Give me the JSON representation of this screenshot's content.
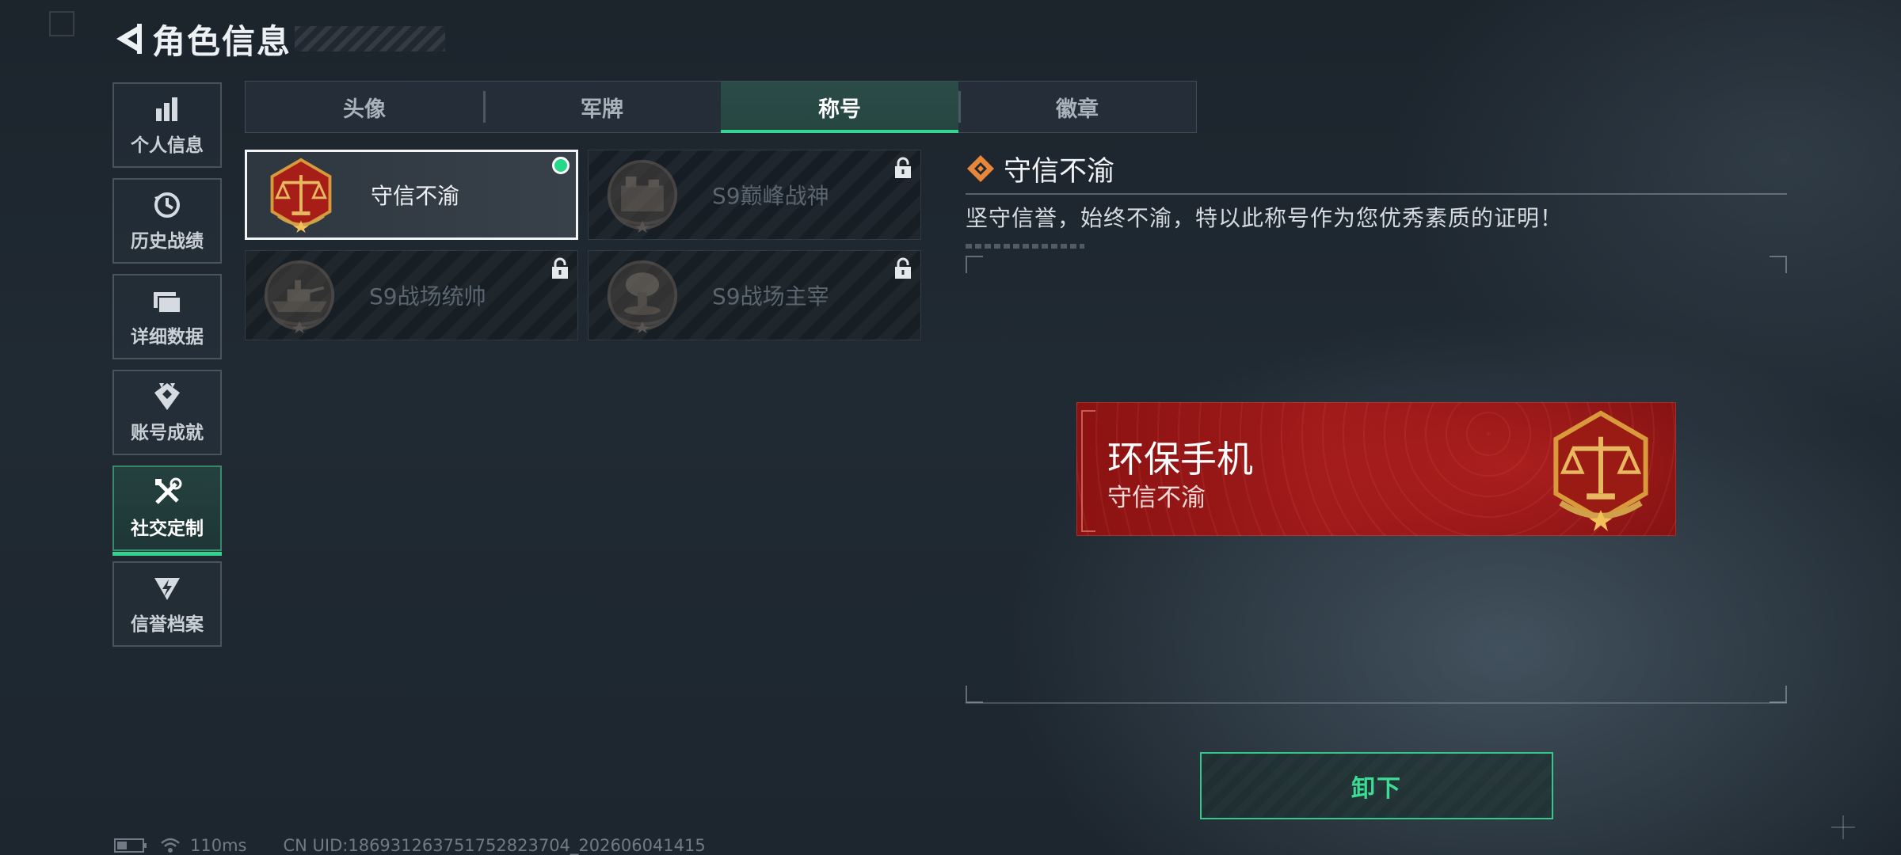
{
  "header": {
    "title": "角色信息",
    "back_icon": "chevron-left-icon"
  },
  "sidebar": {
    "items": [
      {
        "label": "个人信息",
        "icon": "bar-chart-icon",
        "active": false
      },
      {
        "label": "历史战绩",
        "icon": "history-clock-icon",
        "active": false
      },
      {
        "label": "详细数据",
        "icon": "folder-icon",
        "active": false
      },
      {
        "label": "账号成就",
        "icon": "achievement-icon",
        "active": false
      },
      {
        "label": "社交定制",
        "icon": "tools-icon",
        "active": true
      },
      {
        "label": "信誉档案",
        "icon": "emblem-icon",
        "active": false
      }
    ]
  },
  "tabs": [
    {
      "label": "头像",
      "active": false
    },
    {
      "label": "军牌",
      "active": false
    },
    {
      "label": "称号",
      "active": true
    },
    {
      "label": "徽章",
      "active": false
    }
  ],
  "titles": [
    {
      "name": "守信不渝",
      "badge": "justice-scale-badge",
      "selected": true,
      "locked": false
    },
    {
      "name": "S9巅峰战神",
      "badge": "fortress-badge",
      "selected": false,
      "locked": true
    },
    {
      "name": "S9战场统帅",
      "badge": "warship-badge",
      "selected": false,
      "locked": true
    },
    {
      "name": "S9战场主宰",
      "badge": "mushroom-cloud-badge",
      "selected": false,
      "locked": true
    }
  ],
  "detail": {
    "title": "守信不渝",
    "description": "坚守信誉，始终不渝，特以此称号作为您优秀素质的证明！"
  },
  "nameplate": {
    "player_name": "环保手机",
    "title": "守信不渝"
  },
  "actions": {
    "unequip_label": "卸下"
  },
  "status": {
    "ping": "110ms",
    "uid": "CN UID:186931263751752823704_202606041415"
  },
  "colors": {
    "accent_green": "#35d28e",
    "nameplate_red": "#9e1a1a",
    "background": "#1f2830"
  }
}
